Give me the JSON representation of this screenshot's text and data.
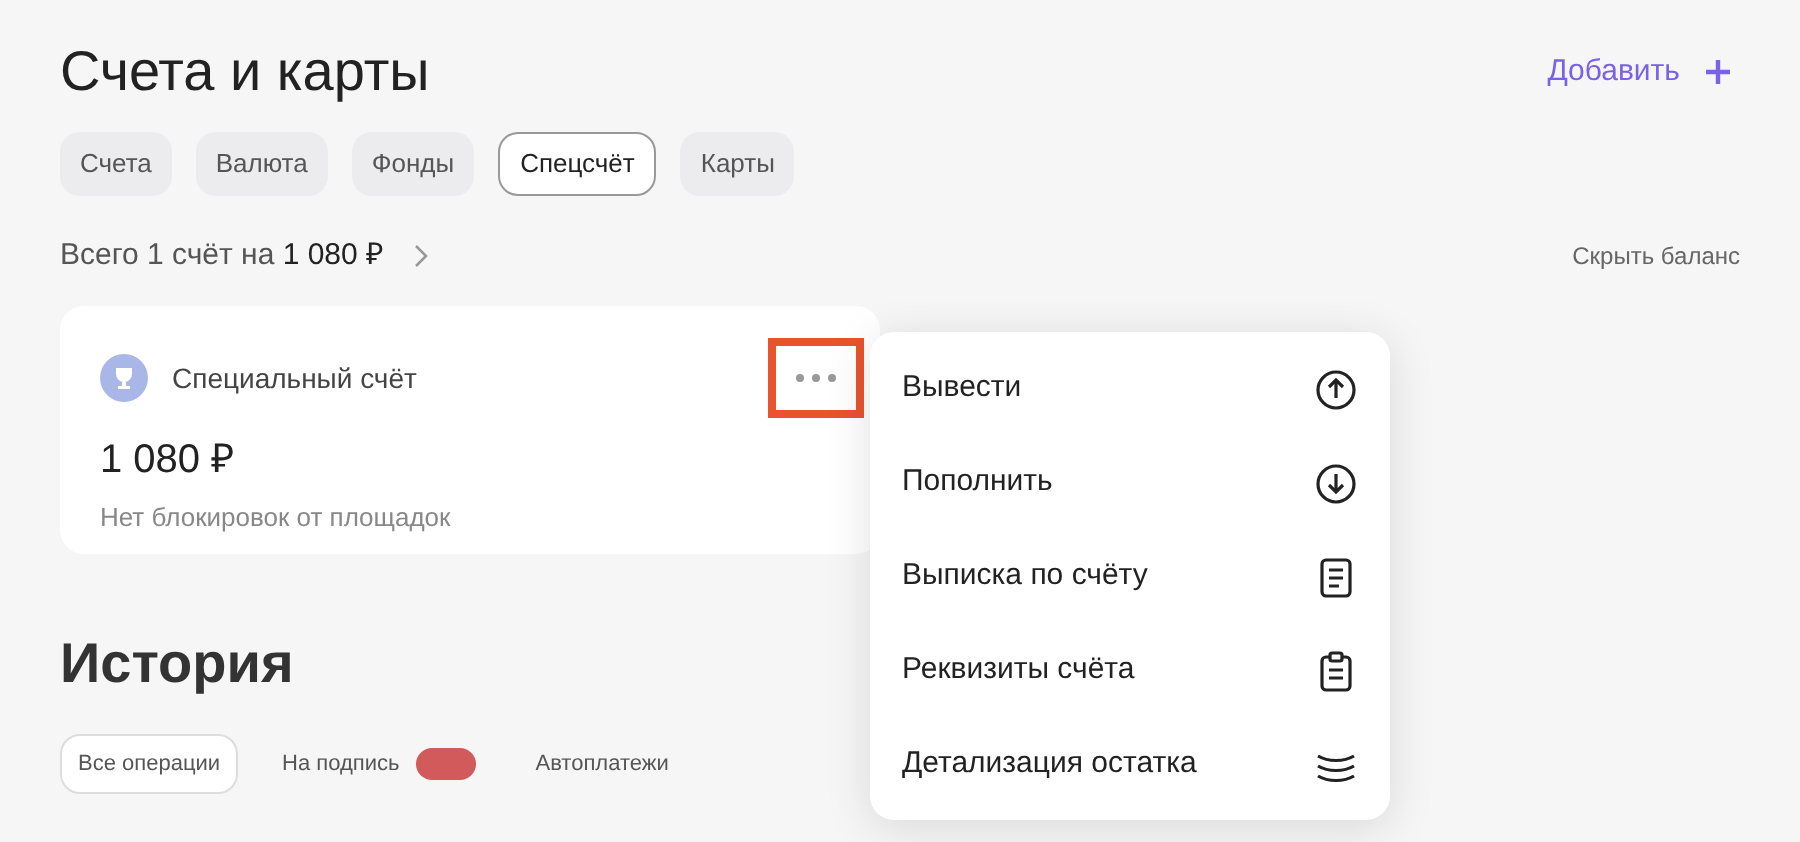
{
  "title": "Счета и карты",
  "add_link": "Добавить",
  "tabs": [
    {
      "label": "Счета",
      "selected": false
    },
    {
      "label": "Валюта",
      "selected": false
    },
    {
      "label": "Фонды",
      "selected": false
    },
    {
      "label": "Спецсчёт",
      "selected": true
    },
    {
      "label": "Карты",
      "selected": false
    }
  ],
  "summary": {
    "text": "Всего 1 счёт на",
    "amount": "1 080 ₽"
  },
  "hide_balance": "Скрыть баланс",
  "account": {
    "name": "Специальный счёт",
    "amount": "1 080 ₽",
    "note": "Нет блокировок от площадок",
    "more_highlighted": true
  },
  "menu": [
    {
      "label": "Вывести",
      "kind": "upload"
    },
    {
      "label": "Пополнить",
      "kind": "download"
    },
    {
      "label": "Выписка по счёту",
      "kind": "document"
    },
    {
      "label": "Реквизиты счёта",
      "kind": "clipboard"
    },
    {
      "label": "Детализация остатка",
      "kind": "layers"
    }
  ],
  "history": {
    "title": "История",
    "filters": [
      {
        "label": "Все операции",
        "selected": true,
        "badge": false
      },
      {
        "label": "На подпись",
        "selected": false,
        "badge": true
      },
      {
        "label": "Автоплатежи",
        "selected": false,
        "badge": false
      }
    ]
  }
}
